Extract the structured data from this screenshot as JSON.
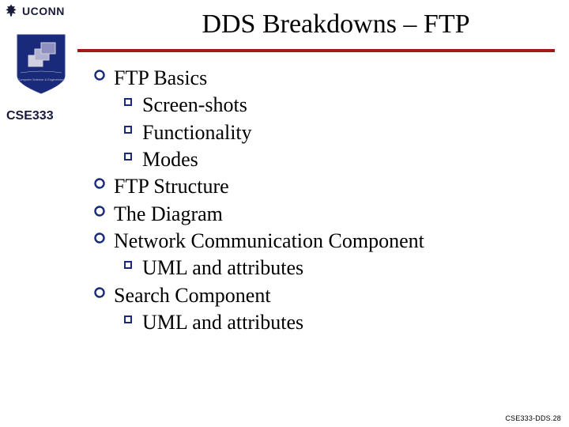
{
  "header": {
    "university": "UCONN"
  },
  "course_tag": "CSE333",
  "title": "DDS Breakdowns – FTP",
  "outline": [
    {
      "label": "FTP Basics",
      "children": [
        {
          "label": "Screen-shots"
        },
        {
          "label": "Functionality"
        },
        {
          "label": "Modes"
        }
      ]
    },
    {
      "label": "FTP Structure",
      "children": []
    },
    {
      "label": "The Diagram",
      "children": []
    },
    {
      "label": "Network Communication Component",
      "children": [
        {
          "label": "UML and attributes"
        }
      ]
    },
    {
      "label": "Search Component",
      "children": [
        {
          "label": "UML and attributes"
        }
      ]
    }
  ],
  "footer": "CSE333-DDS.28",
  "colors": {
    "rule": "#a01818",
    "navy": "#1a2a7a"
  }
}
